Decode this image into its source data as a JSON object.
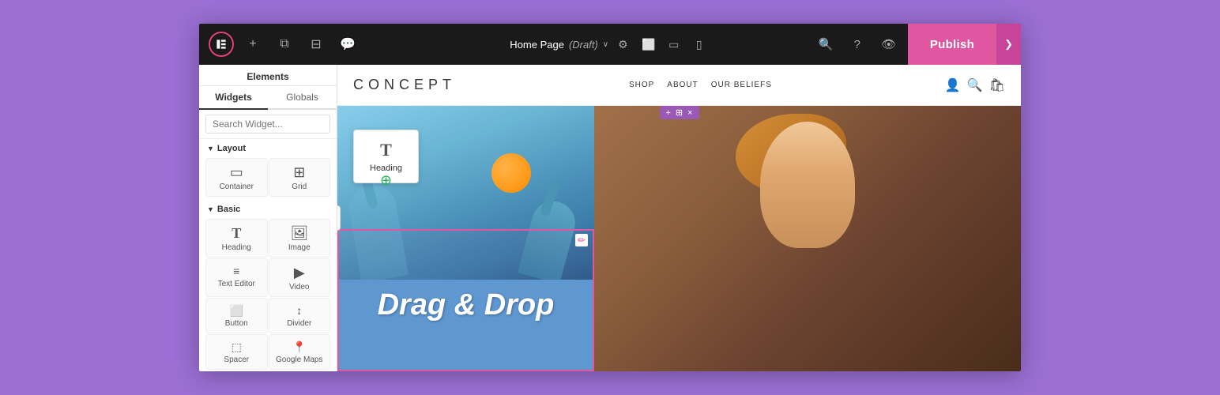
{
  "topbar": {
    "page_title": "Home Page",
    "draft_label": "(Draft)",
    "settings_icon": "⚙",
    "search_icon": "🔍",
    "help_icon": "?",
    "eye_icon": "👁",
    "publish_label": "Publish",
    "chevron_icon": "❯"
  },
  "devices": [
    {
      "label": "Desktop",
      "icon": "🖥"
    },
    {
      "label": "Tablet",
      "icon": "📱"
    },
    {
      "label": "Mobile",
      "icon": "📲"
    }
  ],
  "left_panel": {
    "title": "Elements",
    "tabs": [
      {
        "label": "Widgets",
        "active": true
      },
      {
        "label": "Globals",
        "active": false
      }
    ],
    "search_placeholder": "Search Widget...",
    "sections": [
      {
        "name": "Layout",
        "widgets": [
          {
            "label": "Container",
            "icon": "▭"
          },
          {
            "label": "Grid",
            "icon": "⊞"
          }
        ]
      },
      {
        "name": "Basic",
        "widgets": [
          {
            "label": "Heading",
            "icon": "T"
          },
          {
            "label": "Image",
            "icon": "🖼"
          },
          {
            "label": "Text Editor",
            "icon": "≡"
          },
          {
            "label": "Video",
            "icon": "▶"
          },
          {
            "label": "Button",
            "icon": "⬜"
          },
          {
            "label": "Divider",
            "icon": "↕"
          },
          {
            "label": "Spacer",
            "icon": "⬚"
          },
          {
            "label": "Google Maps",
            "icon": "📍"
          }
        ]
      }
    ]
  },
  "site": {
    "logo": "CONCEPT",
    "nav_links": [
      "SHOP",
      "ABOUT",
      "OUR BELIEFS"
    ],
    "drag_drop_text": "Drag & Drop"
  },
  "section_toolbar": {
    "add_icon": "+",
    "grid_icon": "⊞",
    "close_icon": "×"
  },
  "heading_widget": {
    "label": "Heading"
  }
}
